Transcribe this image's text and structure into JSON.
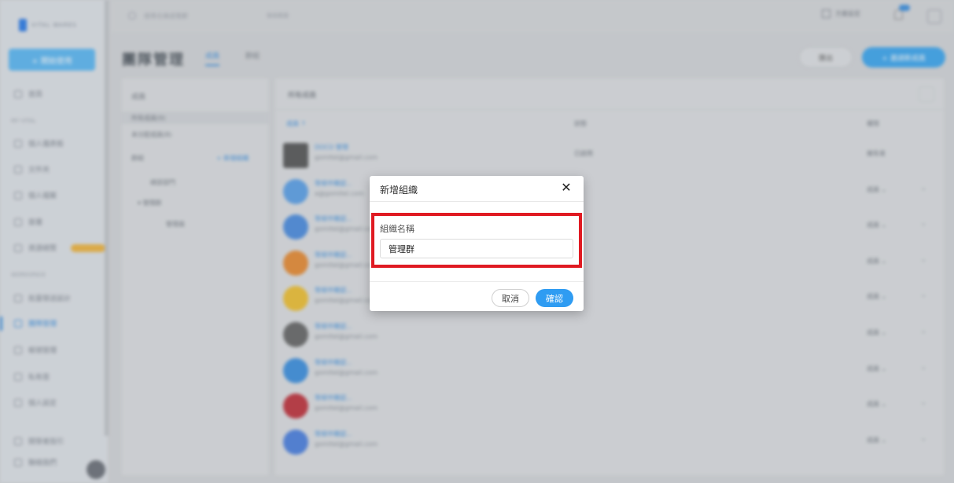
{
  "sidebar": {
    "logo_text": "VITAL WARES",
    "create_button": "+ 開始使用",
    "section_1": "MY VITAL",
    "section_2": "WORKSPACE",
    "items": [
      {
        "label": "首頁",
        "icon": "home-icon"
      },
      {
        "label": "個人儀表板",
        "icon": "dashboard-icon"
      },
      {
        "label": "文件夾",
        "icon": "folder-icon"
      },
      {
        "label": "個人檔案",
        "icon": "profile-icon"
      },
      {
        "label": "簽署",
        "icon": "sign-icon"
      },
      {
        "label": "資源總覽",
        "icon": "resource-icon"
      },
      {
        "label": "批量發送設計",
        "icon": "bulk-icon"
      },
      {
        "label": "團隊管理",
        "icon": "team-icon"
      },
      {
        "label": "帳號管理",
        "icon": "account-icon"
      },
      {
        "label": "私有雲",
        "icon": "cloud-icon"
      },
      {
        "label": "個人設定",
        "icon": "settings-icon"
      }
    ],
    "bottom_items": [
      {
        "label": "開發者指引",
        "icon": "developer-icon"
      },
      {
        "label": "聯絡我們",
        "icon": "contact-icon"
      }
    ]
  },
  "topbar": {
    "search_placeholder": "搜尋名稱或電郵",
    "search_hint": "搜尋範圍",
    "right_label": "方案設定"
  },
  "header": {
    "title": "團隊管理",
    "tabs": [
      "成員",
      "群組"
    ],
    "sort_button": "匯出",
    "new_button": "+ 邀請新成員"
  },
  "left_panel": {
    "title": "成員",
    "items": [
      "所有成員(9)",
      "未分配成員(8)"
    ],
    "group_label": "群組",
    "add_group": "+ 新增組織",
    "groups": [
      "總部部門",
      "管理群",
      "管理員"
    ]
  },
  "main_panel": {
    "title": "所有成員",
    "columns": [
      "成員 ↑",
      "狀態",
      "權限"
    ],
    "rows": [
      {
        "name": "DOCO 管理",
        "email": "gomitel@gmail.com",
        "status": "已啟用",
        "role": "擁有者",
        "avatar_color": "#555555"
      },
      {
        "name": "等候中確認...",
        "email": "a@gomitel.com",
        "status": "",
        "role": "成員 ⌄",
        "avatar_color": "#5aa0e8"
      },
      {
        "name": "等候中確認...",
        "email": "gomitel@gmail.com",
        "status": "",
        "role": "成員 ⌄",
        "avatar_color": "#4a8ce0"
      },
      {
        "name": "等候中確認...",
        "email": "gomitel@gmail.com",
        "status": "",
        "role": "成員 ⌄",
        "avatar_color": "#e88a30"
      },
      {
        "name": "等候中確認...",
        "email": "gomitel@gmail.com",
        "status": "",
        "role": "成員 ⌄",
        "avatar_color": "#f0c030"
      },
      {
        "name": "等候中確認...",
        "email": "gomitel@gmail.com",
        "status": "",
        "role": "成員 ⌄",
        "avatar_color": "#666666"
      },
      {
        "name": "等候中確認...",
        "email": "gomitel@gmail.com",
        "status": "",
        "role": "成員 ⌄",
        "avatar_color": "#3a8fe0"
      },
      {
        "name": "等候中確認...",
        "email": "gomitel@gmail.com",
        "status": "",
        "role": "成員 ⌄",
        "avatar_color": "#c0303a"
      },
      {
        "name": "等候中確認...",
        "email": "gomitel@gmail.com",
        "status": "",
        "role": "成員 ⌄",
        "avatar_color": "#4a7fe0"
      }
    ]
  },
  "modal": {
    "title": "新增組織",
    "close_icon": "close-icon",
    "field_label": "組織名稱",
    "field_value": "管理群",
    "cancel_label": "取消",
    "confirm_label": "確認"
  },
  "colors": {
    "accent": "#2f9cf2",
    "highlight": "#e01a22"
  }
}
